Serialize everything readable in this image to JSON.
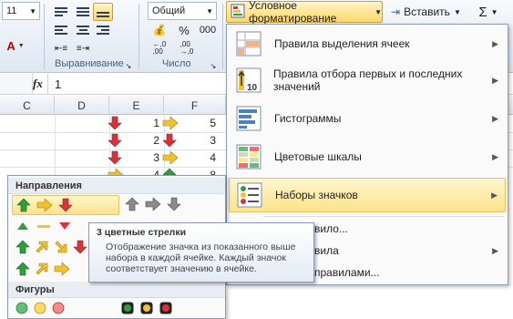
{
  "ribbon": {
    "font_size": "11",
    "number_format": "Общий",
    "percent": "%",
    "thousands": "000",
    "align_group": "Выравнивание",
    "number_group": "Число",
    "conditional_formatting": "Условное форматирование",
    "insert": "Вставить",
    "sum": "Σ"
  },
  "formula_bar": {
    "fx": "fx",
    "value": "1"
  },
  "columns": [
    "C",
    "D",
    "E",
    "F"
  ],
  "cells": {
    "e_values": [
      "1",
      "2",
      "3",
      "4"
    ],
    "f_values": [
      "5",
      "3",
      "4",
      "8"
    ]
  },
  "menu": {
    "items": [
      {
        "label": "Правила выделения ячеек",
        "underline": "в"
      },
      {
        "label": "Правила отбора первых и последних значений"
      },
      {
        "label": "Гистограммы"
      },
      {
        "label": "Цветовые шкалы"
      },
      {
        "label": "Наборы значков"
      }
    ],
    "rule_items": [
      "вило...",
      "вила",
      "правилами..."
    ]
  },
  "icon_sets": {
    "section_directions": "Направления",
    "section_shapes": "Фигуры"
  },
  "tooltip": {
    "title": "3 цветные стрелки",
    "body": "Отображение значка из показанного выше набора в каждой ячейке. Каждый значок соответствует значению в ячейке."
  },
  "colors": {
    "accent_hover": "#ffe38a",
    "ribbon": "#dfe7f2",
    "green": "#2e9e3e",
    "yellow": "#f2c12e",
    "red": "#d9333a",
    "gray": "#8a8a8a"
  }
}
